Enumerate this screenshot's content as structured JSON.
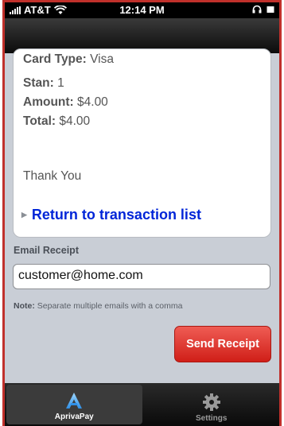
{
  "status_bar": {
    "carrier": "AT&T",
    "time": "12:14 PM"
  },
  "receipt": {
    "card_type_label": "Card Type:",
    "card_type_value": "Visa",
    "stan_label": "Stan:",
    "stan_value": "1",
    "amount_label": "Amount:",
    "amount_value": "$4.00",
    "total_label": "Total:",
    "total_value": "$4.00",
    "thank_you": "Thank You",
    "return_link": "Return to transaction list"
  },
  "email_receipt": {
    "section_label": "Email Receipt",
    "email_value": "customer@home.com",
    "note_label": "Note:",
    "note_text": "Separate multiple emails with a comma",
    "send_button": "Send Receipt"
  },
  "tabs": [
    {
      "label": "AprivaPay",
      "icon": "apriva-logo-icon",
      "active": true
    },
    {
      "label": "Settings",
      "icon": "gear-icon",
      "active": false
    }
  ],
  "colors": {
    "frame_border": "#c0302b",
    "link_blue": "#0025d8",
    "button_red": "#d01f18",
    "content_bg": "#c9ced6"
  }
}
